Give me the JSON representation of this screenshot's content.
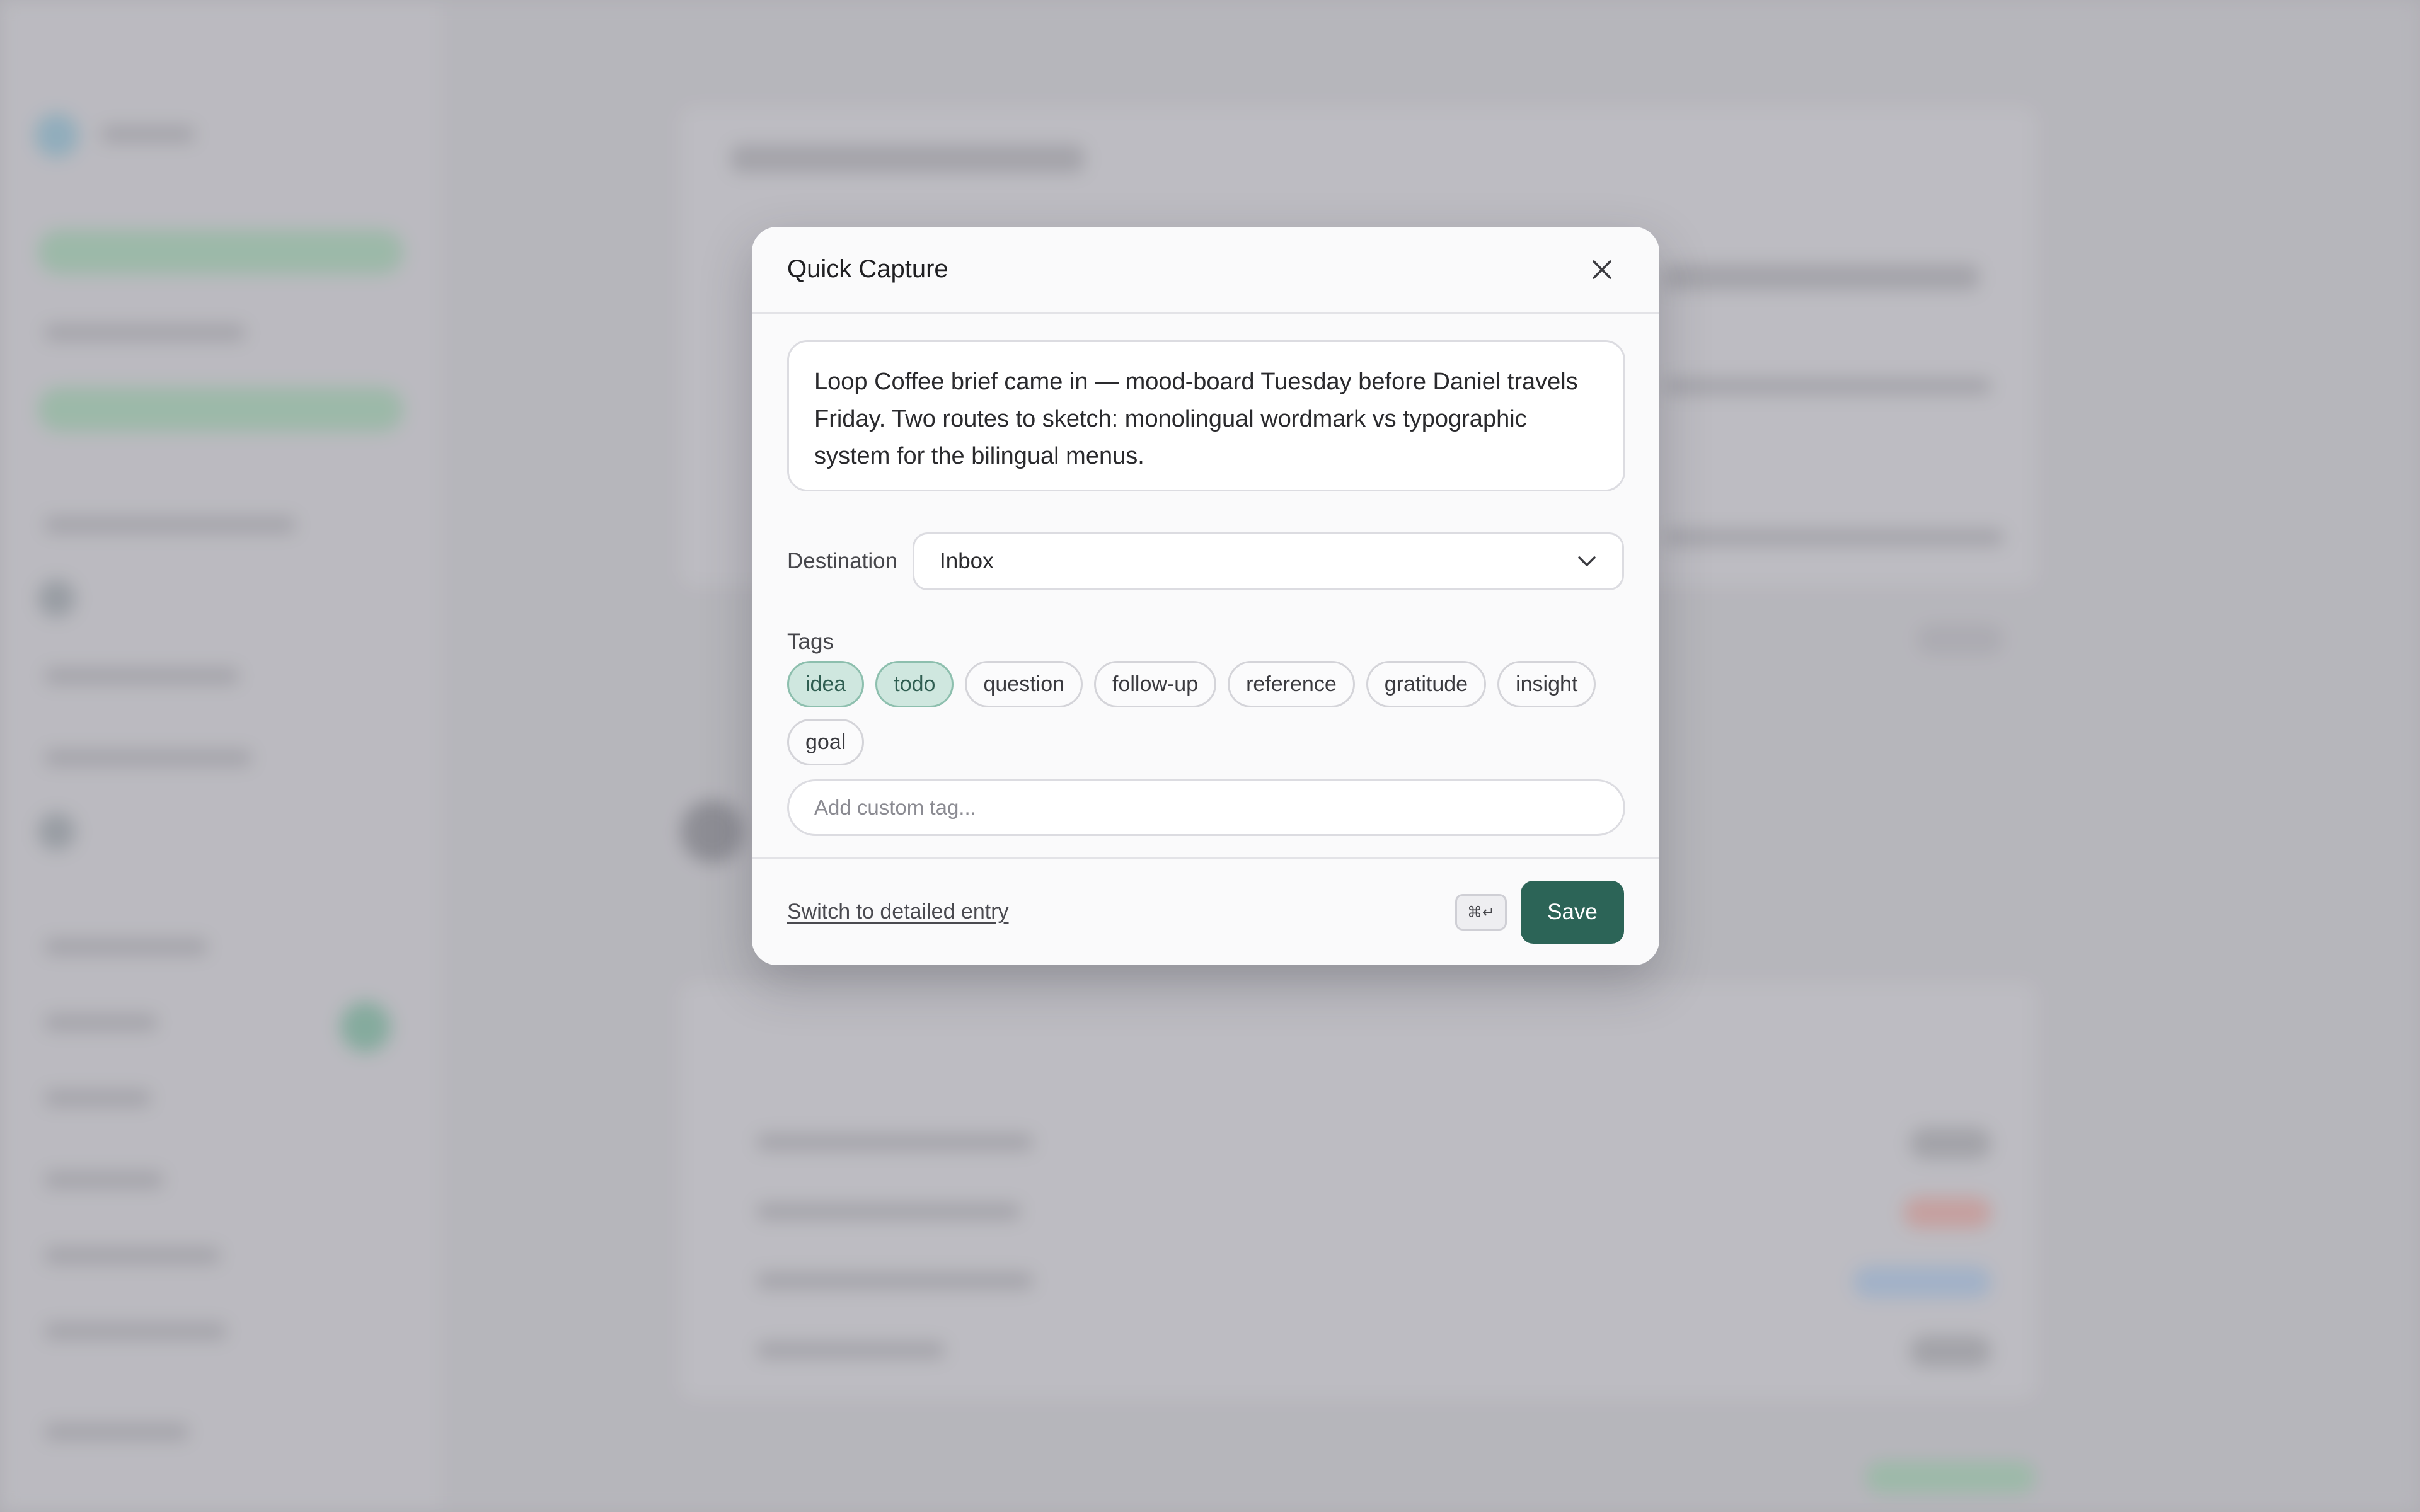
{
  "modal": {
    "title": "Quick Capture",
    "note_text": "Loop Coffee brief came in — mood-board Tuesday before Daniel travels Friday. Two routes to sketch: monolingual wordmark vs typographic system for the bilingual menus.",
    "destination_label": "Destination",
    "destination_value": "Inbox",
    "tags_label": "Tags",
    "tags": [
      {
        "label": "idea",
        "selected": true
      },
      {
        "label": "todo",
        "selected": true
      },
      {
        "label": "question",
        "selected": false
      },
      {
        "label": "follow-up",
        "selected": false
      },
      {
        "label": "reference",
        "selected": false
      },
      {
        "label": "gratitude",
        "selected": false
      },
      {
        "label": "insight",
        "selected": false
      },
      {
        "label": "goal",
        "selected": false
      }
    ],
    "custom_tag_placeholder": "Add custom tag...",
    "switch_link": "Switch to detailed entry",
    "shortcut": "⌘↵",
    "save_label": "Save"
  },
  "icons": {
    "close": "close-icon",
    "dropdown": "chevron-down-icon"
  },
  "colors": {
    "accent": "#2c6457",
    "tag_selected_bg": "#cfe7df",
    "tag_selected_border": "#8dbfae"
  }
}
